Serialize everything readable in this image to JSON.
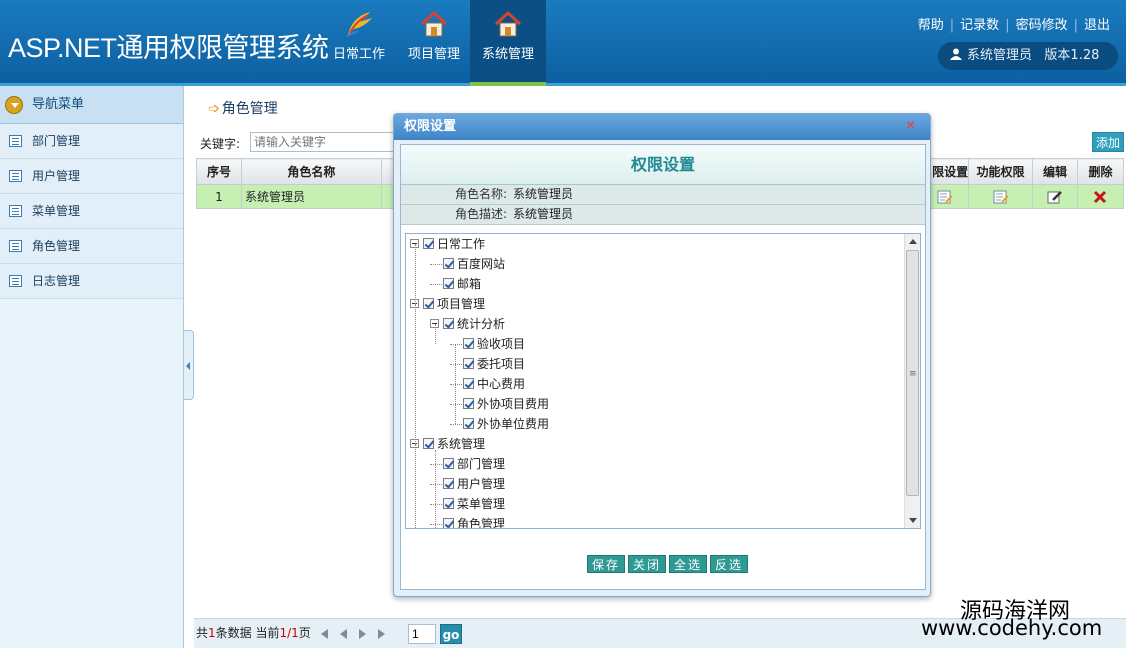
{
  "app": {
    "title": "ASP.NET通用权限管理系统"
  },
  "topnav": [
    {
      "label": "日常工作",
      "icon": "quill-icon"
    },
    {
      "label": "项目管理",
      "icon": "home-icon"
    },
    {
      "label": "系统管理",
      "icon": "home-icon",
      "active": true
    }
  ],
  "toplinks": {
    "help": "帮助",
    "records": "记录数",
    "password": "密码修改",
    "logout": "退出"
  },
  "user": {
    "name": "系统管理员",
    "version": "版本1.28"
  },
  "sidebar": {
    "header": "导航菜单",
    "items": [
      {
        "label": "部门管理"
      },
      {
        "label": "用户管理"
      },
      {
        "label": "菜单管理"
      },
      {
        "label": "角色管理"
      },
      {
        "label": "日志管理"
      }
    ]
  },
  "page": {
    "title": "角色管理",
    "keyword_label": "关键字:",
    "keyword_placeholder": "请输入关键字",
    "add_label": "添加"
  },
  "table": {
    "columns": [
      "序号",
      "角色名称",
      "限设置",
      "功能权限",
      "编辑",
      "删除"
    ],
    "rows": [
      {
        "index": "1",
        "name": "系统管理员"
      }
    ]
  },
  "pager": {
    "prefix": "共",
    "total": "1",
    "mid": "条数据 当前",
    "current": "1/1",
    "suffix": "页",
    "page_input": "1",
    "go": "go"
  },
  "dialog": {
    "bar_title": "权限设置",
    "close": "×",
    "title": "权限设置",
    "role_name_label": "角色名称:",
    "role_name": "系统管理员",
    "role_desc_label": "角色描述:",
    "role_desc": "系统管理员",
    "tree": [
      {
        "label": "日常工作",
        "level": 0
      },
      {
        "label": "百度网站",
        "level": 1
      },
      {
        "label": "邮箱",
        "level": 1
      },
      {
        "label": "项目管理",
        "level": 0
      },
      {
        "label": "统计分析",
        "level": 1
      },
      {
        "label": "验收项目",
        "level": 2
      },
      {
        "label": "委托项目",
        "level": 2
      },
      {
        "label": "中心费用",
        "level": 2
      },
      {
        "label": "外协项目费用",
        "level": 2
      },
      {
        "label": "外协单位费用",
        "level": 2
      },
      {
        "label": "系统管理",
        "level": 0
      },
      {
        "label": "部门管理",
        "level": 1
      },
      {
        "label": "用户管理",
        "level": 1
      },
      {
        "label": "菜单管理",
        "level": 1
      },
      {
        "label": "角色管理",
        "level": 1
      }
    ],
    "buttons": [
      "保存",
      "关闭",
      "全选",
      "反选"
    ]
  },
  "watermark": {
    "line1": "源码海洋网",
    "line2": "www.codehy.com"
  }
}
